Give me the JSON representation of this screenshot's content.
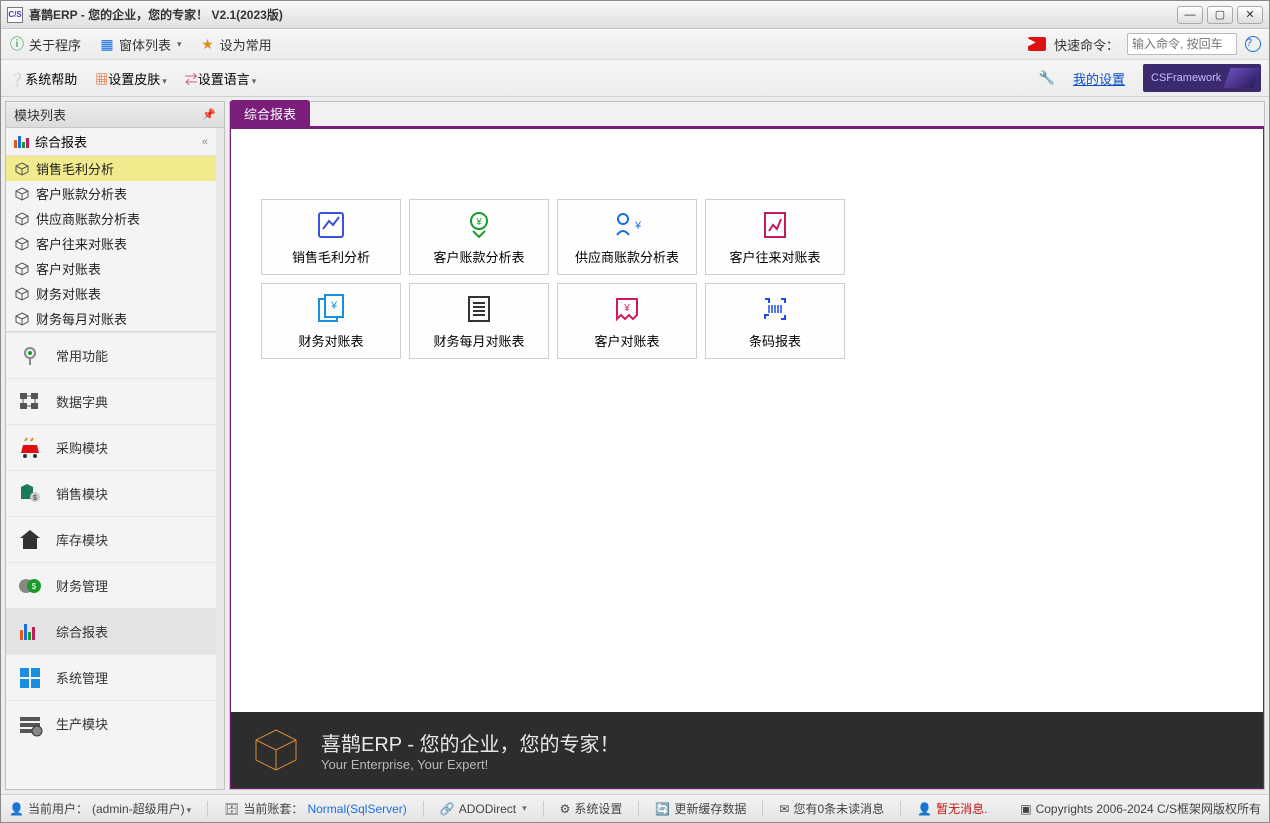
{
  "window": {
    "title": "喜鹊ERP - 您的企业，您的专家！ V2.1(2023版)",
    "app_icon_text": "C/S"
  },
  "toolbar1": {
    "about": "关于程序",
    "windows": "窗体列表",
    "set_default": "设为常用",
    "quick_cmd_label": "快速命令：",
    "quick_cmd_placeholder": "输入命令, 按回车"
  },
  "toolbar2": {
    "help": "系统帮助",
    "skin": "设置皮肤",
    "lang": "设置语言",
    "my_settings": "我的设置",
    "csfw": "CSFramework"
  },
  "sidebar": {
    "header": "模块列表",
    "section_title": "综合报表",
    "items": [
      "销售毛利分析",
      "客户账款分析表",
      "供应商账款分析表",
      "客户往来对账表",
      "客户对账表",
      "财务对账表",
      "财务每月对账表"
    ],
    "modules": [
      "常用功能",
      "数据字典",
      "采购模块",
      "销售模块",
      "库存模块",
      "财务管理",
      "综合报表",
      "系统管理",
      "生产模块"
    ]
  },
  "tabs": {
    "active": "综合报表"
  },
  "tiles": [
    {
      "label": "销售毛利分析",
      "color": "#3b4fe0"
    },
    {
      "label": "客户账款分析表",
      "color": "#1a9a2b"
    },
    {
      "label": "供应商账款分析表",
      "color": "#1a6fe0"
    },
    {
      "label": "客户往来对账表",
      "color": "#c41b5e"
    },
    {
      "label": "财务对账表",
      "color": "#1a8fe0"
    },
    {
      "label": "财务每月对账表",
      "color": "#333"
    },
    {
      "label": "客户对账表",
      "color": "#d11b5e"
    },
    {
      "label": "条码报表",
      "color": "#1a4fe0"
    }
  ],
  "banner": {
    "title": "喜鹊ERP - 您的企业，您的专家！",
    "sub": "Your Enterprise, Your Expert!"
  },
  "status": {
    "user_label": "当前用户：",
    "user_value": "(admin-超级用户)",
    "db_label": "当前账套：",
    "db_value": "Normal(SqlServer)",
    "ado": "ADODirect",
    "sys_settings": "系统设置",
    "refresh_cache": "更新缓存数据",
    "unread": "您有0条未读消息",
    "no_msg": "暂无消息.",
    "copyright": "Copyrights 2006-2024 C/S框架网版权所有"
  }
}
